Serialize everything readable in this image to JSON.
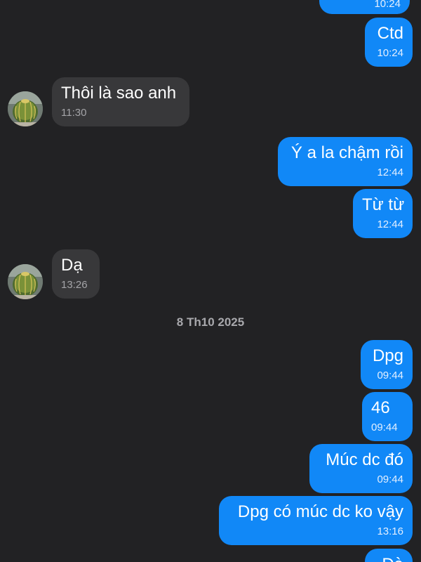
{
  "messages": [
    {
      "direction": "out",
      "text": "",
      "time": "10:24"
    },
    {
      "direction": "out",
      "text": "Ctd",
      "time": "10:24"
    },
    {
      "direction": "in",
      "text": "Thôi là sao anh",
      "time": "11:30"
    },
    {
      "direction": "out",
      "text": "Ý a la chậm rồi",
      "time": "12:44"
    },
    {
      "direction": "out",
      "text": "Từ từ",
      "time": "12:44"
    },
    {
      "direction": "in",
      "text": "Dạ",
      "time": "13:26"
    },
    {
      "direction": "out",
      "text": "Dpg",
      "time": "09:44"
    },
    {
      "direction": "out",
      "text": "46",
      "time": "09:44"
    },
    {
      "direction": "out",
      "text": "Múc dc đó",
      "time": "09:44"
    },
    {
      "direction": "out",
      "text": "Dpg có múc dc ko vậy",
      "time": "13:16"
    },
    {
      "direction": "out",
      "text": "Dà",
      "time": ""
    }
  ],
  "date_separator": "8 Th10 2025",
  "avatar_icon": "cactus-avatar-icon",
  "colors": {
    "background": "#222224",
    "outgoing_bubble": "#1188f7",
    "incoming_bubble": "#38383a",
    "time_outgoing": "#e3efff",
    "time_incoming": "#a4a4a8",
    "date_separator": "#a8a8ac"
  }
}
